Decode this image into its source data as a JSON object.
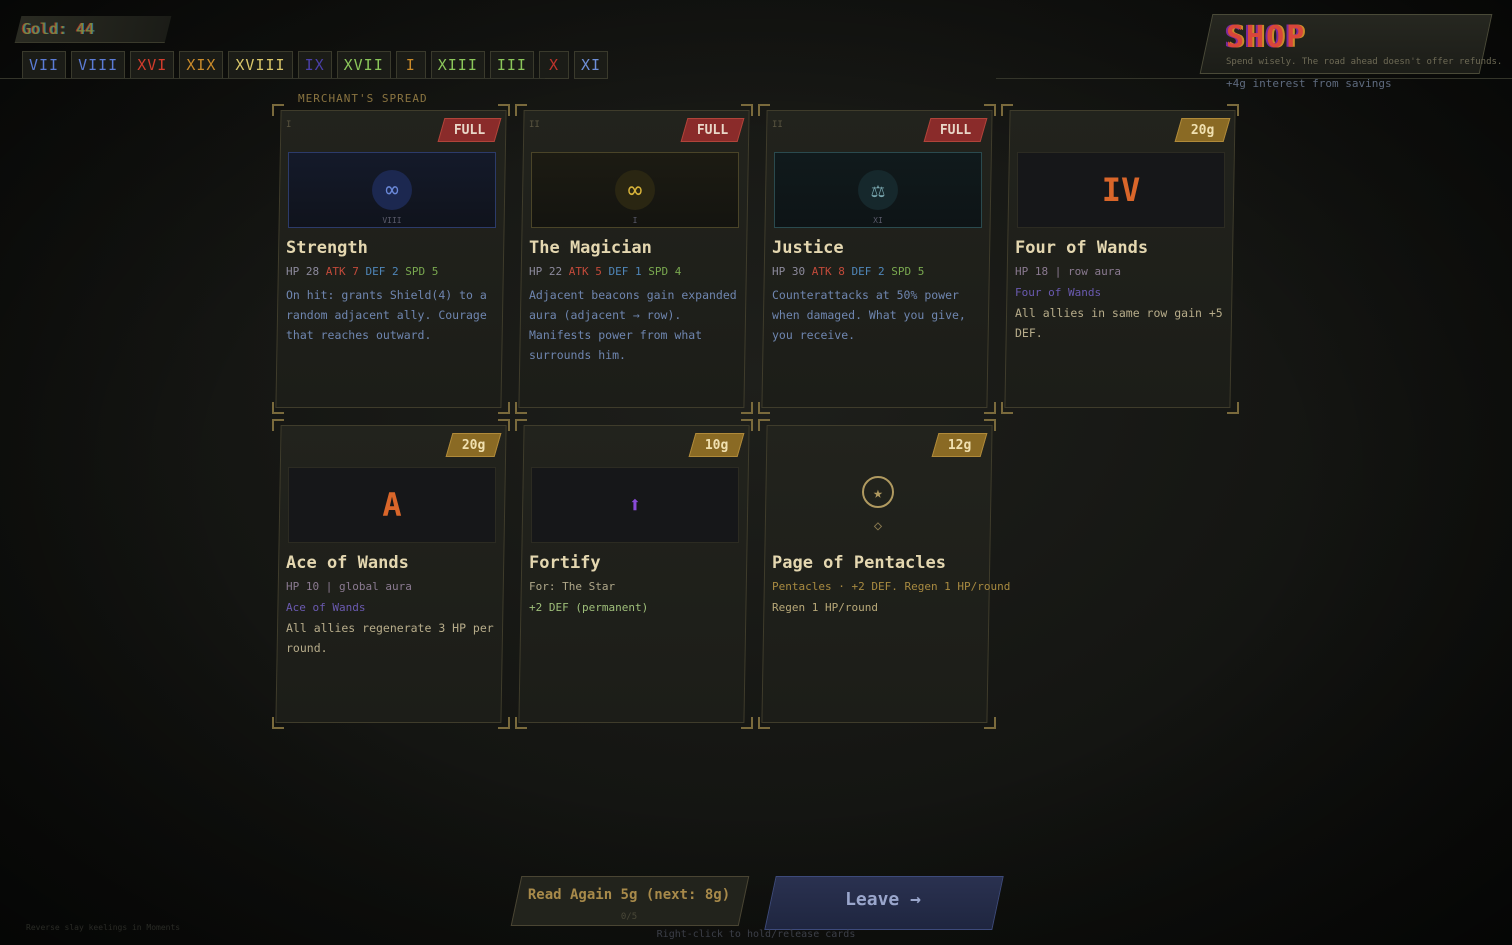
{
  "hud": {
    "gold": "Gold: 44",
    "collection": [
      {
        "label": "VII",
        "color": "#5b7bd4"
      },
      {
        "label": "VIII",
        "color": "#5b7bd4"
      },
      {
        "label": "XVI",
        "color": "#d23c2c"
      },
      {
        "label": "XIX",
        "color": "#c98a2a"
      },
      {
        "label": "XVIII",
        "color": "#d9c66a"
      },
      {
        "label": "IX",
        "color": "#4a3fa8"
      },
      {
        "label": "XVII",
        "color": "#8bc65a"
      },
      {
        "label": "I",
        "color": "#c98a2a"
      },
      {
        "label": "XIII",
        "color": "#8bc65a"
      },
      {
        "label": "III",
        "color": "#8bc65a"
      },
      {
        "label": "X",
        "color": "#c0342c"
      },
      {
        "label": "XI",
        "color": "#6e8fd8"
      }
    ]
  },
  "shop": {
    "title": "SHOP",
    "subtitle": "Spend wisely. The road ahead doesn't offer refunds.",
    "interest": "+4g interest from savings",
    "section_label": "MERCHANT'S SPREAD"
  },
  "cards": [
    {
      "numeral_tab": "I",
      "tag": "FULL",
      "art_glyph": "∞",
      "art_sub": "VIII",
      "name": "Strength",
      "hp": "HP 28",
      "atk": "ATK 7",
      "def": "DEF 2",
      "spd": "SPD 5",
      "desc": "On hit: grants Shield(4) to a random adjacent ally. Courage that reaches outward."
    },
    {
      "numeral_tab": "II",
      "tag": "FULL",
      "art_glyph": "∞",
      "art_sub": "I",
      "name": "The Magician",
      "hp": "HP 22",
      "atk": "ATK 5",
      "def": "DEF 1",
      "spd": "SPD 4",
      "desc": "Adjacent beacons gain expanded aura (adjacent → row). Manifests power from what surrounds him."
    },
    {
      "numeral_tab": "II",
      "tag": "FULL",
      "art_glyph": "⚖",
      "art_sub": "XI",
      "name": "Justice",
      "hp": "HP 30",
      "atk": "ATK 8",
      "def": "DEF 2",
      "spd": "SPD 5",
      "desc": "Counterattacks at 50% power when damaged. What you give, you receive."
    },
    {
      "tag": "20g",
      "art_glyph": "IV",
      "name": "Four of Wands",
      "meta": "HP 18 | row aura",
      "meta2": "Four of Wands",
      "effect": "All allies in same row gain +5 DEF."
    },
    {
      "tag": "20g",
      "art_glyph": "A",
      "name": "Ace of Wands",
      "meta": "HP 10 | global aura",
      "meta2": "Ace of Wands",
      "effect": "All allies regenerate 3 HP per round."
    },
    {
      "tag": "10g",
      "art_glyph": "⬆",
      "name": "Fortify",
      "for": "For: The Star",
      "effect": "+2 DEF (permanent)"
    },
    {
      "tag": "12g",
      "art_glyph": "★",
      "art_glyph2": "◇",
      "name": "Page of Pentacles",
      "meta": "Pentacles · +2 DEF. Regen 1 HP/round",
      "effect": "Regen 1 HP/round"
    }
  ],
  "bottom": {
    "read_again": "Read Again 5g (next: 8g)",
    "read_again_count": "0/5",
    "leave": "Leave →",
    "hint": "Right-click to hold/release cards",
    "footer_note": "Reverse slay keelings in Moments"
  },
  "colors": {
    "full_tag": "#8a2b2a",
    "price_tag": "#8a6a24",
    "leave_button": "#2a3150"
  }
}
